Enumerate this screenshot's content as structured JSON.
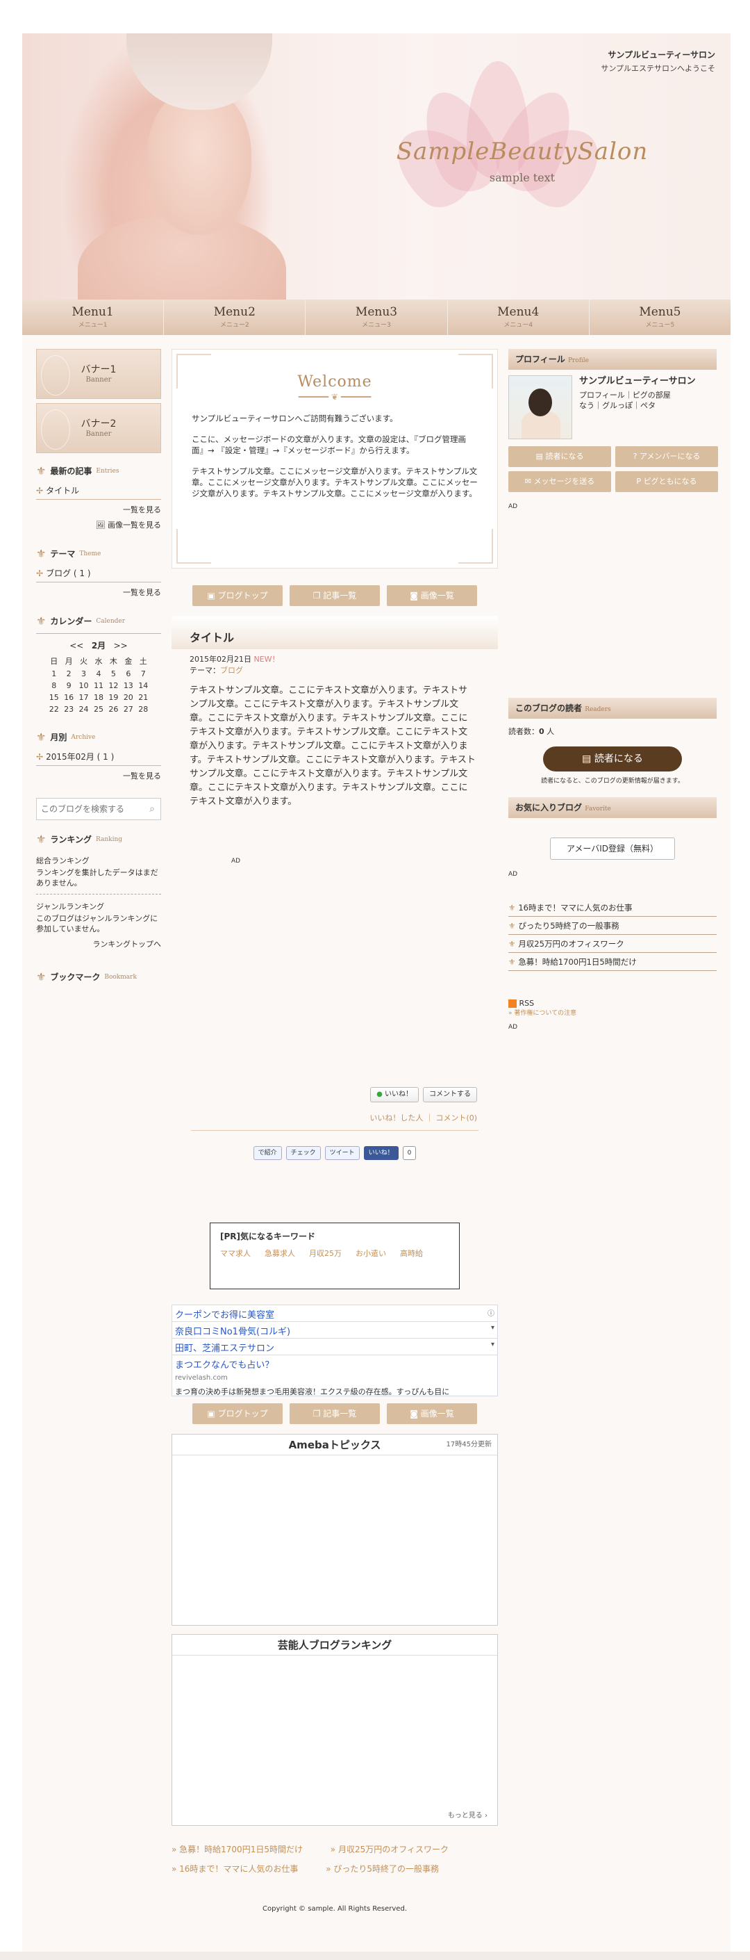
{
  "header": {
    "brand": "SampleBeautySalon",
    "brand_sub": "sample text",
    "site_name": "サンプルビューティーサロン",
    "site_desc": "サンプルエステサロンへようこそ"
  },
  "nav": [
    {
      "label": "Menu1",
      "sub": "メニュー1"
    },
    {
      "label": "Menu2",
      "sub": "メニュー2"
    },
    {
      "label": "Menu3",
      "sub": "メニュー3"
    },
    {
      "label": "Menu4",
      "sub": "メニュー4"
    },
    {
      "label": "Menu5",
      "sub": "メニュー5"
    }
  ],
  "left": {
    "banners": [
      {
        "title": "バナー1",
        "sub": "Banner"
      },
      {
        "title": "バナー2",
        "sub": "Banner"
      }
    ],
    "recent": {
      "title": "最新の記事",
      "en": "Entries",
      "item": "タイトル",
      "more": "一覧を見る",
      "image_more": "画像一覧を見る"
    },
    "theme": {
      "title": "テーマ",
      "en": "Theme",
      "item": "ブログ ( 1 )",
      "more": "一覧を見る"
    },
    "calendar": {
      "title": "カレンダー",
      "en": "Calender",
      "prev": "<<",
      "month": "2月",
      "next": ">>",
      "weekdays": [
        "日",
        "月",
        "火",
        "水",
        "木",
        "金",
        "土"
      ],
      "rows": [
        [
          "1",
          "2",
          "3",
          "4",
          "5",
          "6",
          "7"
        ],
        [
          "8",
          "9",
          "10",
          "11",
          "12",
          "13",
          "14"
        ],
        [
          "15",
          "16",
          "17",
          "18",
          "19",
          "20",
          "21"
        ],
        [
          "22",
          "23",
          "24",
          "25",
          "26",
          "27",
          "28"
        ]
      ]
    },
    "archive": {
      "title": "月別",
      "en": "Archive",
      "item": "2015年02月 ( 1 )",
      "more": "一覧を見る"
    },
    "search": {
      "placeholder": "このブログを検索する"
    },
    "ranking": {
      "title": "ランキング",
      "en": "Ranking",
      "total_label": "総合ランキング",
      "total_text": "ランキングを集計したデータはまだありません。",
      "genre_label": "ジャンルランキング",
      "genre_text": "このブログはジャンルランキングに参加していません。",
      "top_link": "ランキングトップへ"
    },
    "bookmark": {
      "title": "ブックマーク",
      "en": "Bookmark"
    }
  },
  "welcome": {
    "title": "Welcome",
    "p1": "サンプルビューティーサロンへご訪問有難うございます。",
    "p2": "ここに、メッセージボードの文章が入ります。文章の設定は、『ブログ管理画面』→ 『設定・管理』→『メッセージボード』から行えます。",
    "p3": "テキストサンプル文章。ここにメッセージ文章が入ります。テキストサンプル文章。ここにメッセージ文章が入ります。テキストサンプル文章。ここにメッセージ文章が入ります。テキストサンプル文章。ここにメッセージ文章が入ります。"
  },
  "buttons": {
    "top": "ブログトップ",
    "list": "記事一覧",
    "images": "画像一覧"
  },
  "entry": {
    "title": "タイトル",
    "date": "2015年02月21日",
    "new": "NEW！",
    "theme_label": "テーマ：",
    "theme": "ブログ",
    "body": "テキストサンプル文章。ここにテキスト文章が入ります。テキストサンプル文章。ここにテキスト文章が入ります。テキストサンプル文章。ここにテキスト文章が入ります。テキストサンプル文章。ここにテキスト文章が入ります。テキストサンプル文章。ここにテキスト文章が入ります。テキストサンプル文章。ここにテキスト文章が入ります。テキストサンプル文章。ここにテキスト文章が入ります。テキストサンプル文章。ここにテキスト文章が入ります。テキストサンプル文章。ここにテキスト文章が入ります。テキストサンプル文章。ここにテキスト文章が入ります。",
    "ad": "AD",
    "like": "いいね！",
    "comment": "コメントする",
    "liked_by": "いいね！した人",
    "comments": "コメント(0)",
    "share": [
      "で紹介",
      "チェック",
      "ツイート",
      "いいね！",
      "0"
    ]
  },
  "keywords": {
    "title": "[PR]気になるキーワード",
    "items": [
      "ママ求人",
      "急募求人",
      "月収25万",
      "お小遣い",
      "高時給"
    ]
  },
  "ads": {
    "rows": [
      "クーポンでお得に美容室",
      "奈良口コミNo1骨気(コルギ)",
      "田町、芝浦エステサロン",
      "まつエクなんでも占い？"
    ],
    "url": "revivelash.com",
    "desc": "まつ育の決め手は新発想まつ毛用美容液！エクステ級の存在感。すっぴんも目に"
  },
  "topics": {
    "title": "Amebaトピックス",
    "updated": "17時45分更新"
  },
  "geinin": {
    "title": "芸能人ブログランキング",
    "more": "もっと見る"
  },
  "bottom_links": [
    "急募！時給1700円1日5時間だけ",
    "月収25万円のオフィスワーク",
    "16時まで！ママに人気のお仕事",
    "ぴったり5時終了の一般事務"
  ],
  "copyright": "Copyright © sample. All Rights Reserved.",
  "right": {
    "profile_title": "プロフィール",
    "profile_en": "Profile",
    "name": "サンプルビューティーサロン",
    "links": "プロフィール｜ピグの部屋\nなう｜グルっぽ｜ペタ",
    "btn_reader": "読者になる",
    "btn_member": "アメンバーになる",
    "btn_message": "メッセージを送る",
    "btn_pigg": "ピグともになる",
    "ad": "AD",
    "readers_title": "このブログの読者",
    "readers_en": "Readers",
    "readers_label": "読者数：",
    "readers_count": "0",
    "readers_unit": " 人",
    "big_btn": "読者になる",
    "readers_note": "読者になると、このブログの更新情報が届きます。",
    "fav_title": "お気に入りブログ",
    "fav_en": "Favorite",
    "ameba_btn": "アメーバID登録（無料）",
    "jobs": [
      "16時まで！ママに人気のお仕事",
      "ぴったり5時終了の一般事務",
      "月収25万円のオフィスワーク",
      "急募！時給1700円1日5時間だけ"
    ],
    "rss": "RSS",
    "rss_sub": "著作権についての注意"
  }
}
